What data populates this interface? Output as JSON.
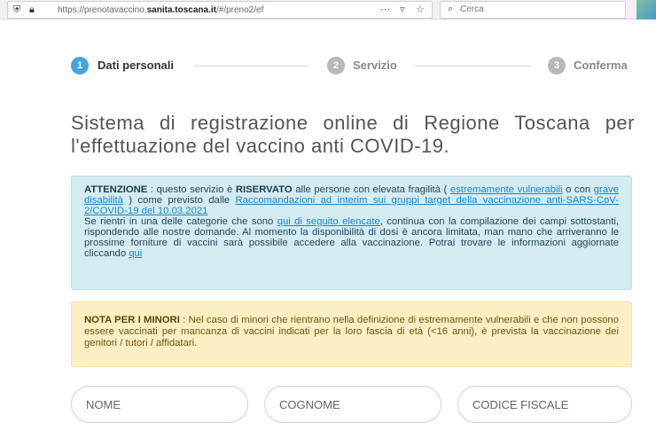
{
  "browser": {
    "url_prefix": "https://prenotavaccino.",
    "url_domain": "sanita.toscana.it",
    "url_suffix": "/#/preno2/ef",
    "search_placeholder": "Cerca"
  },
  "stepper": {
    "steps": [
      {
        "number": "1",
        "label": "Dati personali",
        "color": "#4aa3df",
        "active": true
      },
      {
        "number": "2",
        "label": "Servizio",
        "color": "#b8b8b8",
        "active": false
      },
      {
        "number": "3",
        "label": "Conferma",
        "color": "#b8b8b8",
        "active": false
      }
    ]
  },
  "title": "Sistema di registrazione online di Regione Toscana per l'effettuazione del vaccino anti COVID-19.",
  "info_alert": {
    "attention_label": "ATTENZIONE",
    "t1": " : questo servizio è ",
    "reserved_label": "RISERVATO",
    "t2": " alle persone con elevata fragilità ( ",
    "link_vulnerable": "estremamente vulnerabili",
    "t3": " o con ",
    "link_disability": "grave disabilità",
    "t4": " ) come previsto dalle ",
    "link_recommendations": "Raccomandazioni ad interim sui gruppi target della vaccinazione anti-SARS-CoV-2/COVID-19 del 10.03.2021",
    "t5": "Se rientri in una delle categorie che sono ",
    "link_categories": "qui di seguito elencate",
    "t6": ", continua con la compilazione dei campi sottostanti, rispondendo alle nostre domande. Al momento la disponibilità di dosi è ancora limitata, man mano che arriveranno le prossime forniture di vaccini sarà possibile accedere alla vaccinazione. Potrai trovare le informazioni aggiornate cliccando ",
    "link_here": "qui"
  },
  "minors_alert": {
    "label": "NOTA PER I MINORI",
    "text": " : Nel caso di minori che rientrano nella definizione di estremamente vulnerabili e che non possono essere vaccinati per mancanza di vaccini indicati per la loro fascia di età (<16 anni), è prevista la vaccinazione dei genitori / tutori / affidatari."
  },
  "form": {
    "first_name_placeholder": "NOME",
    "last_name_placeholder": "COGNOME",
    "tax_code_placeholder": "CODICE FISCALE"
  },
  "colors": {
    "accent": "#4aa3df",
    "info_bg": "#d2ecf1",
    "warn_bg": "#fcefc4",
    "link": "#1f83c6"
  }
}
